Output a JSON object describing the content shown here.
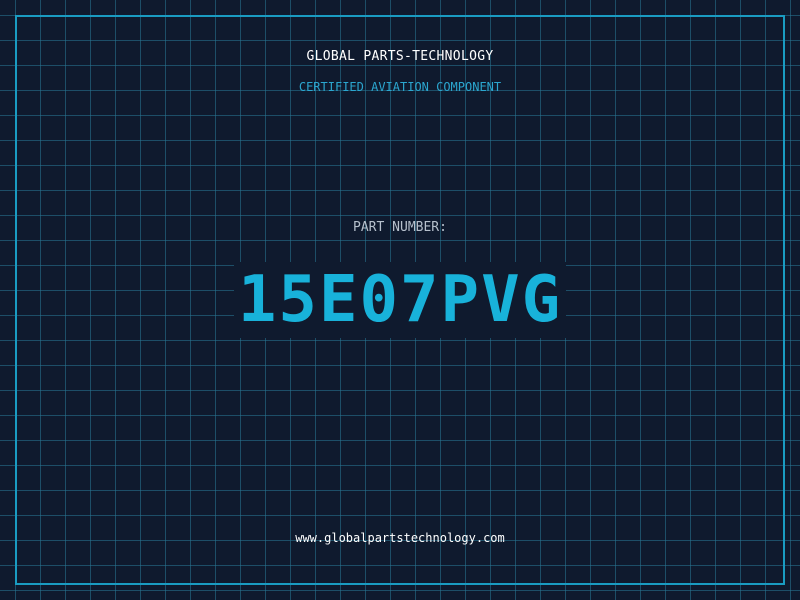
{
  "header": {
    "company": "GLOBAL PARTS-TECHNOLOGY",
    "subtitle": "CERTIFIED AVIATION COMPONENT"
  },
  "part": {
    "label": "PART NUMBER:",
    "number": "15E07PVG"
  },
  "footer": {
    "website": "www.globalpartstechnology.com"
  },
  "colors": {
    "background": "#0f1a2e",
    "accent": "#18b2da",
    "grid": "#1e6a86",
    "border": "#1a9cc2"
  }
}
